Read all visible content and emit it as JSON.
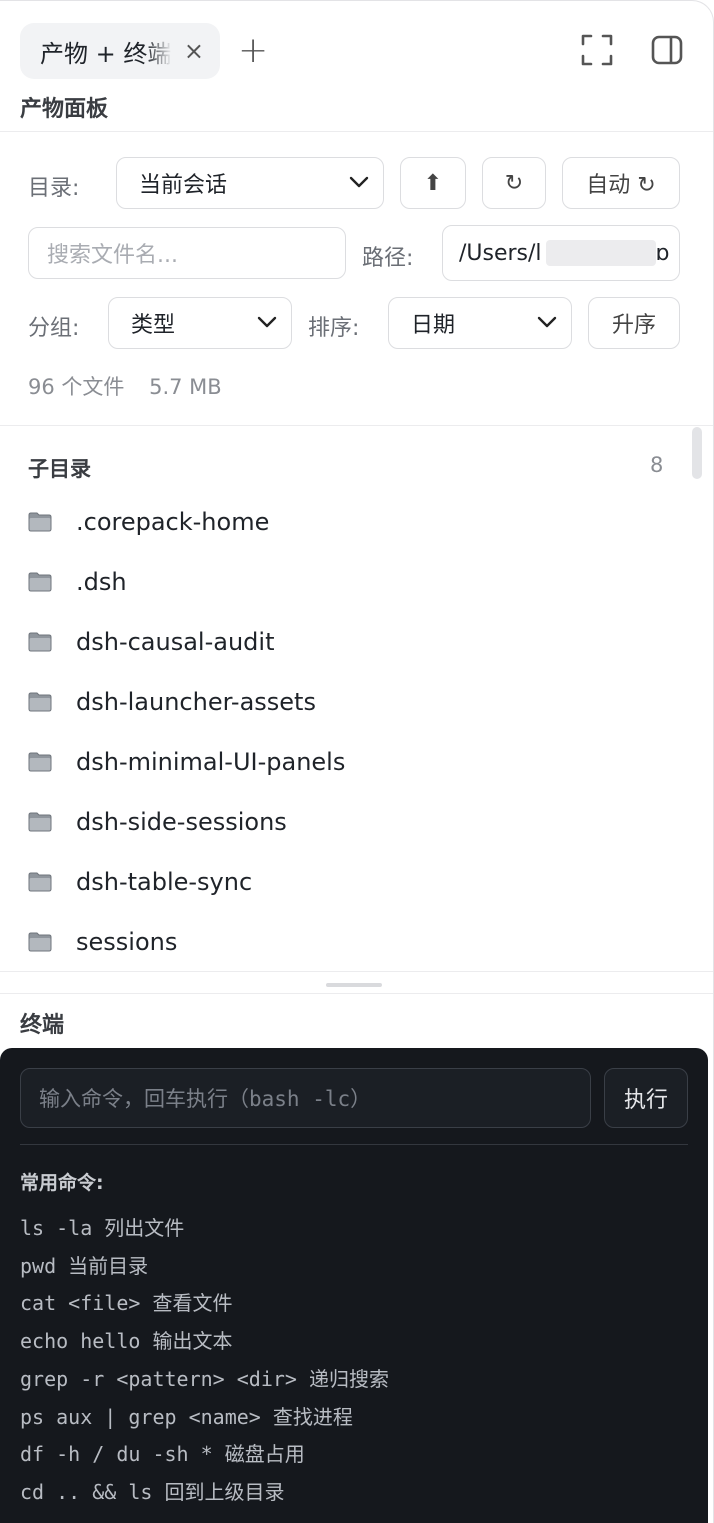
{
  "tab": {
    "label": "产物 + 终端",
    "close": "×",
    "add": "+"
  },
  "panel": {
    "title": "产物面板"
  },
  "controls": {
    "dir_label": "目录:",
    "dir_value": "当前会话",
    "up_button": "⬆",
    "refresh_button": "↻",
    "auto_button": "自动 ↻",
    "search_placeholder": "搜索文件名...",
    "path_label": "路径:",
    "path_value": "/Users/l",
    "path_tail": "ɒ",
    "group_label": "分组:",
    "group_value": "类型",
    "sort_label": "排序:",
    "sort_value": "日期",
    "order_button": "升序"
  },
  "stats": {
    "count": "96 个文件",
    "size": "5.7 MB"
  },
  "subdirs": {
    "title": "子目录",
    "count": "8",
    "items": [
      ".corepack-home",
      ".dsh",
      "dsh-causal-audit",
      "dsh-launcher-assets",
      "dsh-minimal-UI-panels",
      "dsh-side-sessions",
      "dsh-table-sync",
      "sessions"
    ]
  },
  "terminal": {
    "title": "终端",
    "input_placeholder": "输入命令，回车执行（bash -lc）",
    "run_button": "执行",
    "common_title": "常用命令:",
    "commands": [
      "ls -la 列出文件",
      "pwd 当前目录",
      "cat <file> 查看文件",
      "echo hello 输出文本",
      "grep -r <pattern> <dir> 递归搜索",
      "ps aux | grep <name> 查找进程",
      "df -h / du -sh * 磁盘占用",
      "cd .. && ls 回到上级目录"
    ]
  },
  "colors": {
    "terminal_bg": "#15181d",
    "border": "#dcdde0",
    "muted": "#8a8d93"
  }
}
